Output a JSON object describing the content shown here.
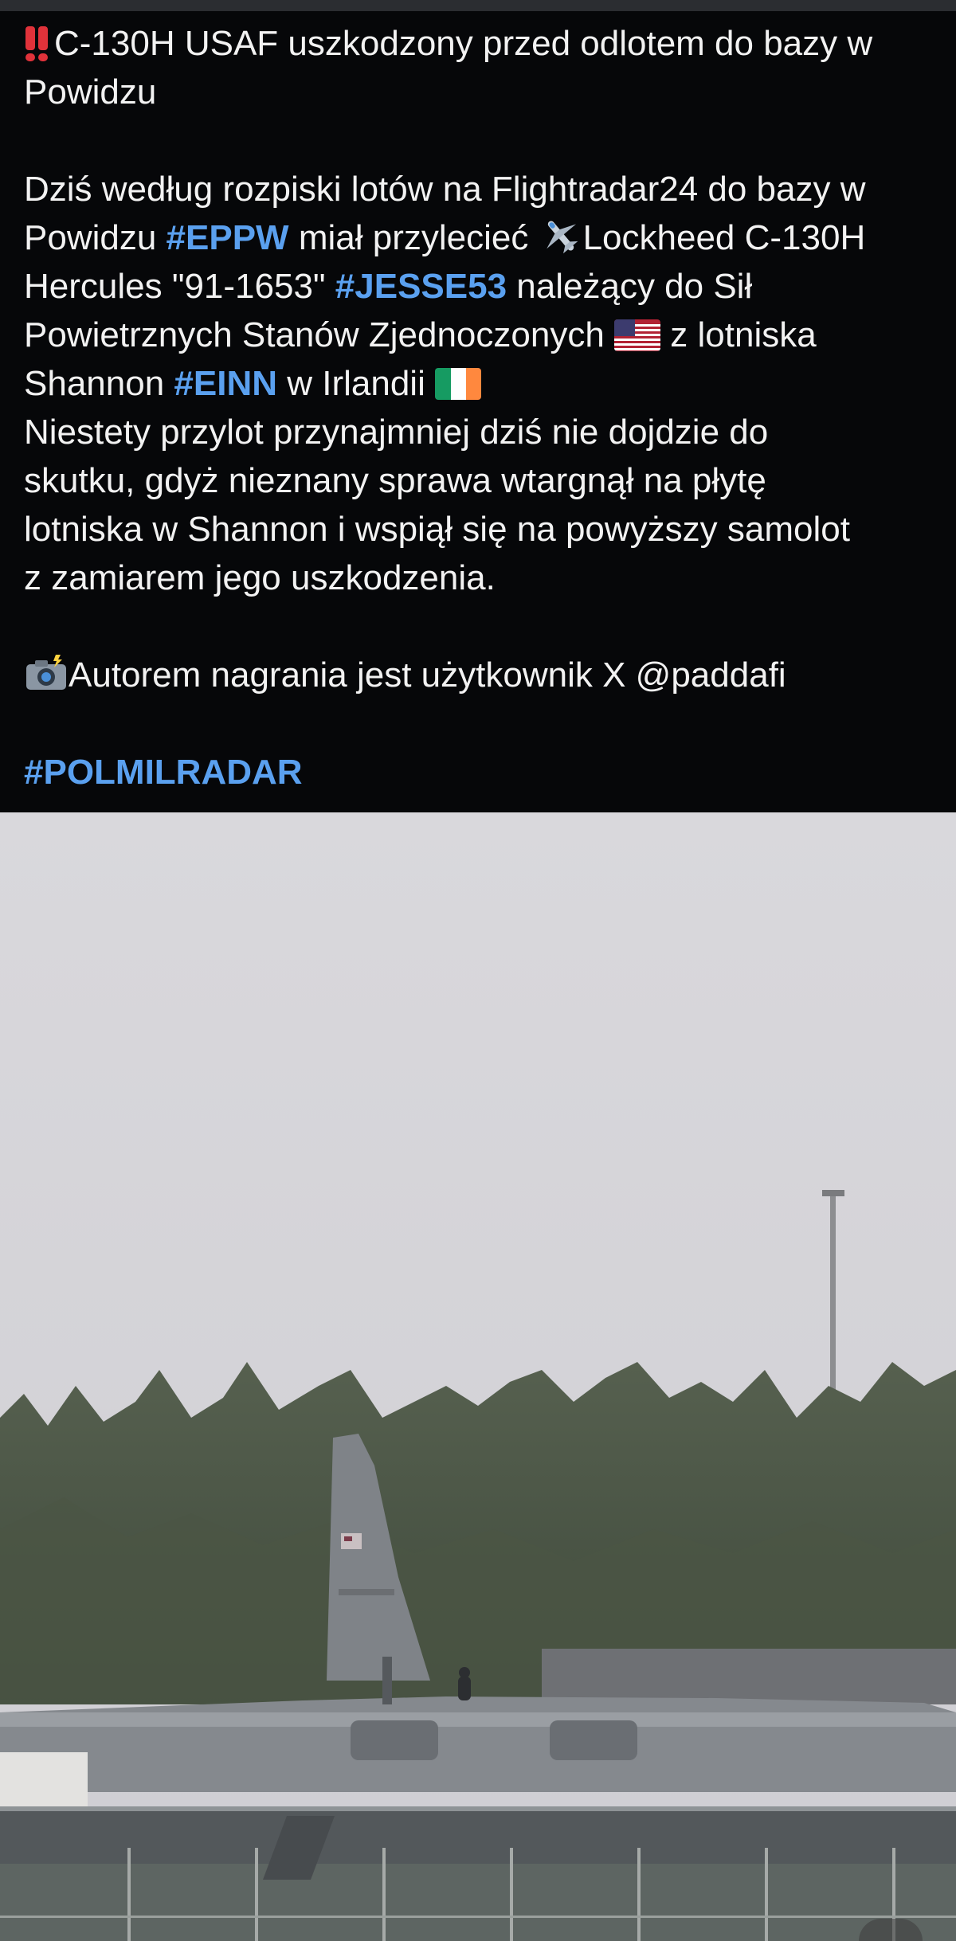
{
  "post": {
    "title_line_1": "C-130H USAF uszkodzony przed odlotem do bazy w",
    "title_line_2": "Powidzu",
    "p1_l1": "Dziś według rozpiski lotów na Flightradar24 do bazy w",
    "p1_l2_a": "Powidzu ",
    "p1_l2_tag": "#EPPW",
    "p1_l2_b": " miał przylecieć ",
    "p1_l2_c": "Lockheed C-130H",
    "p1_l3_a": "Hercules \"91-1653\" ",
    "p1_l3_tag": "#JESSE53",
    "p1_l3_b": " należący do Sił",
    "p1_l4_a": "Powietrznych Stanów Zjednoczonych ",
    "p1_l4_b": " z lotniska",
    "p1_l5_a": "Shannon ",
    "p1_l5_tag": "#EINN",
    "p1_l5_b": " w Irlandii ",
    "p2_l1": "Niestety przylot przynajmniej dziś nie dojdzie do",
    "p2_l2": "skutku, gdyż nieznany sprawa wtargnął na płytę",
    "p2_l3": "lotniska w Shannon i wspiął się na powyższy samolot",
    "p2_l4": "z zamiarem jego uszkodzenia.",
    "credit": "Autorem nagrania jest użytkownik X @paddafi",
    "channel_tag": "#POLMILRADAR"
  },
  "icons": {
    "title_icon": "double-exclamation-icon",
    "plane_icon": "airplane-icon",
    "us_flag": "us-flag-icon",
    "ie_flag": "ireland-flag-icon",
    "camera_icon": "camera-flash-icon"
  },
  "colors": {
    "background": "#060709",
    "text": "#f2f2f2",
    "hashtag": "#5aa0ef",
    "alert": "#e0323a"
  }
}
